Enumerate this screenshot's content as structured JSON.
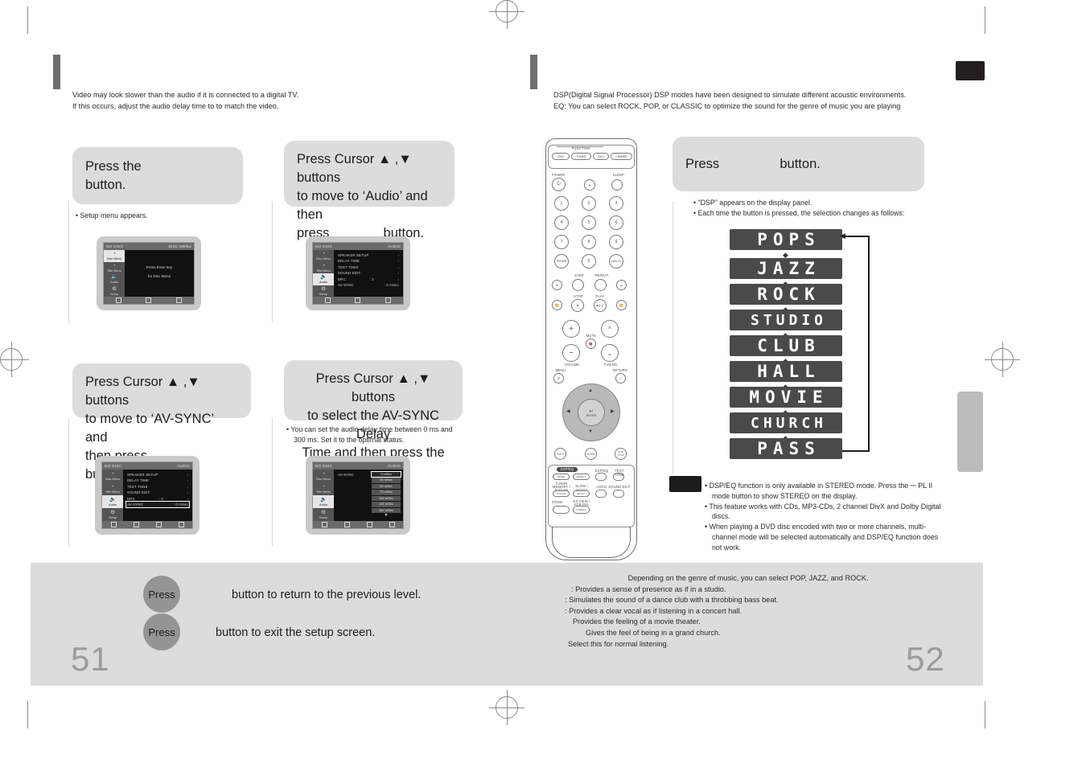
{
  "left_page": {
    "number": "51",
    "intro": [
      "Video may look slower than the audio if it is connected to a digital TV.",
      "If this occurs, adjust the audio delay time to to match the video."
    ],
    "steps": [
      {
        "text_before": "Press the",
        "text_after": "button.",
        "notes": [
          "Setup menu appears."
        ]
      },
      {
        "line1": "Press Cursor ▲ ,▼  buttons",
        "line2": "to move to ‘Audio’ and then",
        "line3_before": "press",
        "line3_after": "button.",
        "notes": []
      },
      {
        "line1": "Press Cursor ▲ ,▼  buttons",
        "line2": "to move to ‘AV-SYNC’ and",
        "line3_before": "then press",
        "line3_after": "button.",
        "notes": []
      },
      {
        "line1": "Press Cursor ▲ ,▼  buttons",
        "line2": "to select the AV-SYNC Delay",
        "line3": "Time  and then press the",
        "line4": "button.",
        "notes": [
          "You can set the audio delay time between 0 ms and 300 ms. Set it to the optimal status."
        ]
      }
    ],
    "tv_screens": {
      "screen1": {
        "title_left": "NO DISC",
        "title_right": "DISC MENU",
        "sidebar": [
          {
            "label": "Disc Menu",
            "icon": "disc-menu-icon",
            "selected": true
          },
          {
            "label": "Title Menu",
            "icon": "title-menu-icon",
            "selected": false
          },
          {
            "label": "Audio",
            "icon": "audio-icon",
            "selected": false
          },
          {
            "label": "Setup",
            "icon": "setup-icon",
            "selected": false
          }
        ],
        "center_lines": [
          "Press Enter key",
          "for Disc Menu"
        ]
      },
      "screen2": {
        "title_left": "NO DISC",
        "title_right": "AUDIO",
        "sidebar": [
          {
            "label": "Disc Menu",
            "icon": "disc-menu-icon",
            "selected": false
          },
          {
            "label": "Title Menu",
            "icon": "title-menu-icon",
            "selected": false
          },
          {
            "label": "Audio",
            "icon": "audio-icon",
            "selected": true
          },
          {
            "label": "Setup",
            "icon": "setup-icon",
            "selected": false
          }
        ],
        "rows": [
          {
            "label": "SPEAKER SETUP",
            "value": "",
            "arrow": "›",
            "highlight": false
          },
          {
            "label": "DELAY TIME",
            "value": "",
            "arrow": "›",
            "highlight": false
          },
          {
            "label": "TEST TONE",
            "value": "",
            "arrow": "›",
            "highlight": false
          },
          {
            "label": "SOUND EDIT",
            "value": "",
            "arrow": "›",
            "highlight": false
          },
          {
            "label": "DRC",
            "value": ": 3",
            "arrow": "›",
            "highlight": false
          },
          {
            "label": "AV-SYNC",
            "value": ": 0 mSec",
            "arrow": "",
            "highlight": false
          }
        ]
      },
      "screen3": {
        "title_left": "NO DISC",
        "title_right": "AUDIO",
        "sidebar": [
          {
            "label": "Disc Menu",
            "icon": "disc-menu-icon",
            "selected": false
          },
          {
            "label": "Title Menu",
            "icon": "title-menu-icon",
            "selected": false
          },
          {
            "label": "Audio",
            "icon": "audio-icon",
            "selected": true
          },
          {
            "label": "Setup",
            "icon": "setup-icon",
            "selected": false
          }
        ],
        "rows": [
          {
            "label": "SPEAKER SETUP",
            "value": "",
            "arrow": "›",
            "highlight": false
          },
          {
            "label": "DELAY TIME",
            "value": "",
            "arrow": "›",
            "highlight": false
          },
          {
            "label": "TEST TONE",
            "value": "",
            "arrow": "›",
            "highlight": false
          },
          {
            "label": "SOUND EDIT",
            "value": "",
            "arrow": "›",
            "highlight": false
          },
          {
            "label": "DRC",
            "value": ": 3",
            "arrow": "›",
            "highlight": false
          },
          {
            "label": "AV-SYNC",
            "value": ": 0 mSec",
            "arrow": "",
            "highlight": true
          }
        ]
      },
      "screen4": {
        "title_left": "NO DISC",
        "title_right": "AUDIO",
        "sidebar": [
          {
            "label": "Disc Menu",
            "icon": "disc-menu-icon",
            "selected": false
          },
          {
            "label": "Title Menu",
            "icon": "title-menu-icon",
            "selected": false
          },
          {
            "label": "Audio",
            "icon": "audio-icon",
            "selected": true
          },
          {
            "label": "Setup",
            "icon": "setup-icon",
            "selected": false
          }
        ],
        "row_label": "AV-SYNC",
        "options": [
          "0 mSec",
          "25 mSec",
          "50 mSec",
          "75 mSec",
          "100 mSec",
          "125 mSec",
          "150 mSec"
        ],
        "selected_option": "0 mSec",
        "more_arrow": "▼"
      }
    },
    "footer": [
      {
        "button_label": "Press",
        "text": "button to return to the previous level."
      },
      {
        "button_label": "Press",
        "text": "button to exit the setup screen."
      }
    ]
  },
  "right_page": {
    "number": "52",
    "intro": [
      "DSP(Digital Signal Processor) DSP modes have been designed to simulate different acoustic environments.",
      "EQ: You can select ROCK, POP, or CLASSIC to optimize the sound for the genre of music you are playing"
    ],
    "step": {
      "text_before": "Press",
      "text_after": "button.",
      "notes": [
        "\"DSP\" appears on the display panel.",
        "Each time the button is pressed, the selection changes as follows:"
      ]
    },
    "dsp_modes": [
      "POPS",
      "JAZZ",
      "ROCK",
      "STUDIO",
      "CLUB",
      "HALL",
      "MOVIE",
      "CHURCH",
      "PASS"
    ],
    "notice": [
      "DSP/EQ function is only available in STEREO mode. Press the ⎓ PL II mode button to show STEREO on the display.",
      "This feature works with CDs, MP3-CDs, 2 channel DivX and Dolby Digital discs.",
      "When playing a DVD disc encoded with two or more channels, multi-channel mode will be selected automatically and DSP/EQ function does not work."
    ],
    "descriptions": [
      "Depending on the genre of music, you can select POP, JAZZ, and ROCK.",
      ": Provides a sense of presence as if in a studio.",
      ": Simulates the sound of a dance club with a throbbing bass beat.",
      ": Provides a clear vocal as if listening in a concert hall.",
      "Provides the feeling of a movie theater.",
      "Gives the feel of being in a grand church.",
      "Select this for normal listening."
    ]
  },
  "remote": {
    "function_label": "FUNCTION",
    "function_buttons": [
      "DVD",
      "TUNER",
      "AUX",
      "DIMMER"
    ],
    "power_label": "POWER",
    "sleep_label": "SLEEP",
    "power_icon": "power-icon",
    "eject_icon": "eject-icon",
    "numbers": [
      "1",
      "2",
      "3",
      "4",
      "5",
      "6",
      "7",
      "8",
      "9"
    ],
    "remain_label": "REMAIN",
    "zero_label": "0",
    "cancel_label": "CANCEL",
    "step_label": "STEP",
    "repeat_label": "REPEAT",
    "stop_label": "STOP",
    "play_label": "PLAY",
    "transport_icons": [
      "prev-track-icon",
      "rewind-icon",
      "stop-icon",
      "play-pause-icon",
      "fast-forward-icon",
      "next-track-icon"
    ],
    "volume_label": "VOLUME",
    "mute_label": "MUTE",
    "tuning_label": "TUNING",
    "menu_label": "MENU",
    "return_label": "RETURN",
    "enter_label": "ENTER",
    "info_label": "INFO",
    "mode_label": "MODE",
    "subtitle_label": "SUB TITLE",
    "pad_label": "DSP/EQ",
    "pad_buttons": [
      "MODE",
      "EFFECT",
      "DSP/EQ",
      "TEST TONE",
      "TUNER MEMORY / P.SCAN",
      "SLOW / MO/ST",
      "LOGO",
      "SOUND EDIT",
      "ZOOM",
      "EZ VIEW / VCR-PAL"
    ]
  }
}
